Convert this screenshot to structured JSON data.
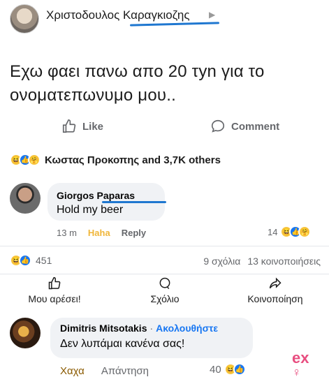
{
  "embedded_post": {
    "author": "Χριστοδουλος Καραγκιοζης",
    "caret": "▶",
    "text": "Εχω φαει πανω απο 20 τyn για το ονοματεπωνυμο μου..",
    "like_label": "Like",
    "comment_label": "Comment",
    "reactions_text": "Κωστας Προκοπης and 3,7K others",
    "reply": {
      "author": "Giorgos Paparas",
      "text": "Hold my beer",
      "time": "13 m",
      "haha_label": "Haha",
      "reply_label": "Reply",
      "reaction_count": "14"
    }
  },
  "post_stats": {
    "reaction_count": "451",
    "comments": "9 σχόλια",
    "shares": "13 κοινοποιήσεις"
  },
  "actions": {
    "like": "Μου αρέσει!",
    "comment": "Σχόλιο",
    "share": "Κοινοποίηση"
  },
  "comment": {
    "author": "Dimitris Mitsotakis",
    "separator": "·",
    "follow_label": "Ακολουθήστε",
    "text": "Δεν λυπάμαι κανένα σας!",
    "haha_label": "Χαχα",
    "reply_label": "Απάντηση",
    "reaction_count": "40"
  },
  "watermark": "ex",
  "colors": {
    "facebook_blue": "#1877f2",
    "haha_yellow": "#f7c744",
    "annotation_blue": "#1f77d0",
    "watermark_pink": "#e5306a"
  }
}
